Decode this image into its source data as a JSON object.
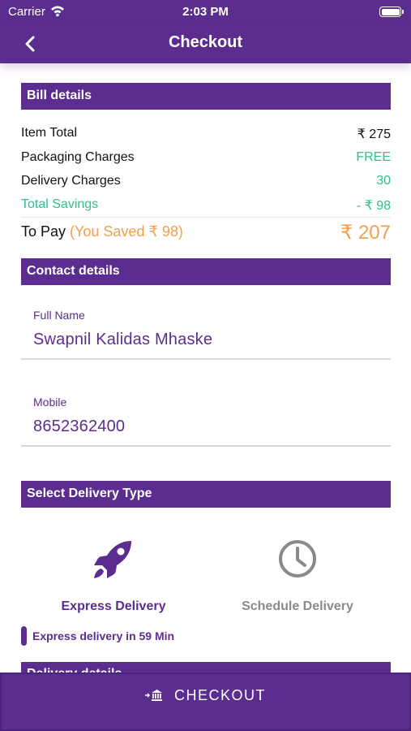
{
  "status_bar": {
    "carrier": "Carrier",
    "time": "2:03 PM"
  },
  "nav": {
    "title": "Checkout"
  },
  "bill": {
    "header": "Bill details",
    "rows": [
      {
        "label": "Item Total",
        "value": "₹ 275"
      },
      {
        "label": "Packaging Charges",
        "value": "FREE"
      },
      {
        "label": "Delivery Charges",
        "value": "30"
      },
      {
        "label": "Total Savings",
        "value": "- ₹ 98"
      }
    ],
    "to_pay_label": "To Pay",
    "saved_text": "(You Saved ₹ 98)",
    "to_pay_value": "₹ 207"
  },
  "contact": {
    "header": "Contact details",
    "full_name_label": "Full Name",
    "full_name_value": "Swapnil Kalidas Mhaske",
    "mobile_label": "Mobile",
    "mobile_value": "8652362400"
  },
  "delivery": {
    "header": "Select Delivery Type",
    "express_label": "Express Delivery",
    "schedule_label": "Schedule Delivery",
    "express_note": "Express delivery in 59 Min",
    "next_header": "Delivery details"
  },
  "checkout": {
    "label": "CHECKOUT"
  },
  "colors": {
    "primary": "#5b2d8e",
    "green": "#2fbf8a",
    "orange": "#f2a04b",
    "inactive": "#8a8a8a"
  },
  "icons": {
    "back": "chevron-left-icon",
    "wifi": "wifi-icon",
    "battery": "battery-icon",
    "express": "rocket-icon",
    "schedule": "clock-icon",
    "checkout": "bank-icon"
  }
}
